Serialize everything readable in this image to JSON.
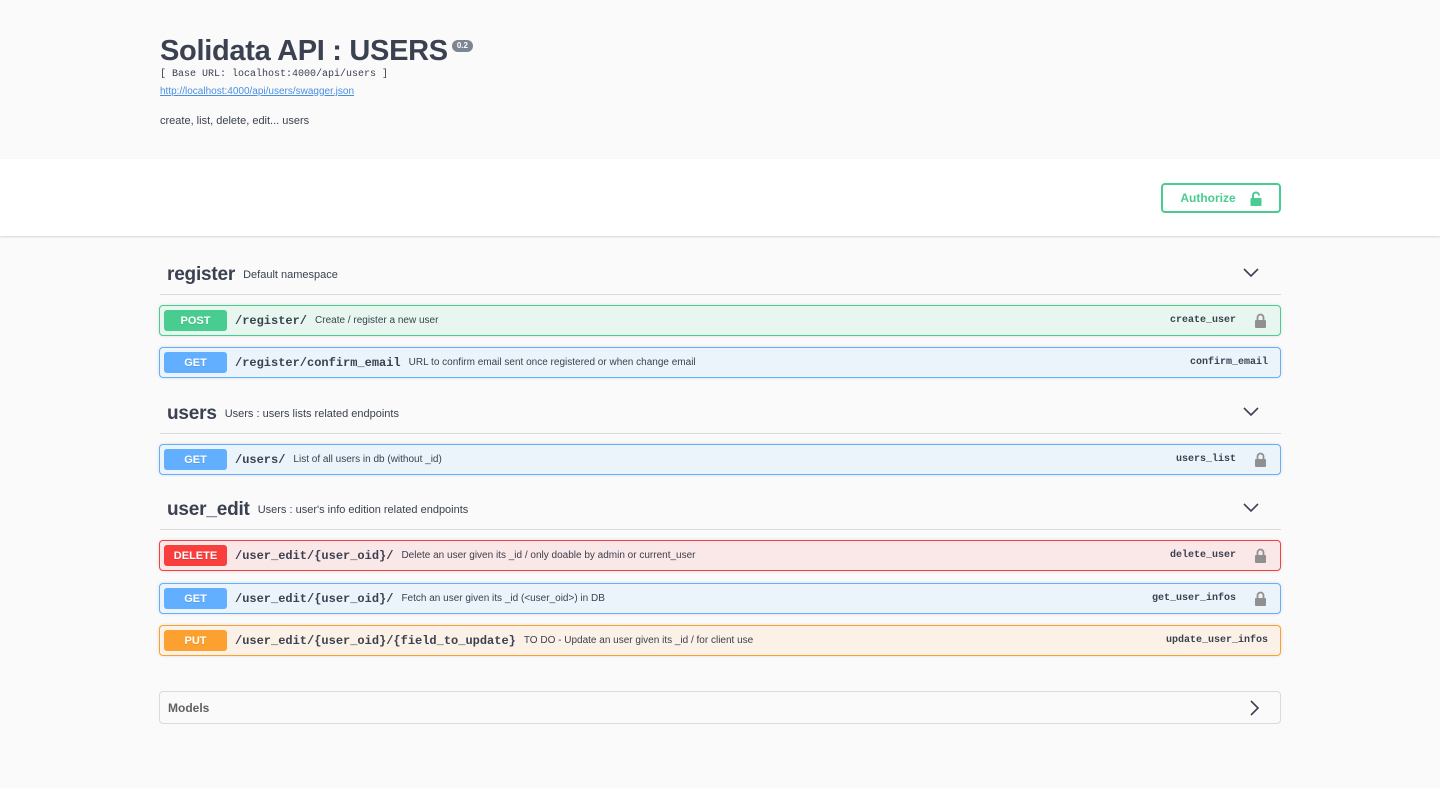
{
  "info": {
    "title": "Solidata API : USERS",
    "version": "0.2",
    "base_url": "[ Base URL: localhost:4000/api/users ]",
    "spec_link": "http://localhost:4000/api/users/swagger.json",
    "description": "create, list, delete, edit... users"
  },
  "authorize": {
    "label": "Authorize",
    "icon": "unlock-icon",
    "color": "#49cc90"
  },
  "colors": {
    "post": "#49cc90",
    "get": "#61affe",
    "delete": "#f93e3e",
    "put": "#fca130"
  },
  "tags": [
    {
      "name": "register",
      "description": "Default namespace",
      "operations": [
        {
          "method": "POST",
          "path": "/register/",
          "summary": "Create / register a new user",
          "operation_id": "create_user",
          "locked": true
        },
        {
          "method": "GET",
          "path": "/register/confirm_email",
          "summary": "URL to confirm email sent once registered or when change email",
          "operation_id": "confirm_email",
          "locked": false
        }
      ]
    },
    {
      "name": "users",
      "description": "Users : users lists related endpoints",
      "operations": [
        {
          "method": "GET",
          "path": "/users/",
          "summary": "List of all users in db (without _id)",
          "operation_id": "users_list",
          "locked": true
        }
      ]
    },
    {
      "name": "user_edit",
      "description": "Users : user's info edition related endpoints",
      "operations": [
        {
          "method": "DELETE",
          "path": "/user_edit/{user_oid}/",
          "summary": "Delete an user given its _id / only doable by admin or current_user",
          "operation_id": "delete_user",
          "locked": true
        },
        {
          "method": "GET",
          "path": "/user_edit/{user_oid}/",
          "summary": "Fetch an user given its _id (<user_oid>) in DB",
          "operation_id": "get_user_infos",
          "locked": true
        },
        {
          "method": "PUT",
          "path": "/user_edit/{user_oid}/{field_to_update}",
          "summary": "TO DO - Update an user given its _id / for client use",
          "operation_id": "update_user_infos",
          "locked": false
        }
      ]
    }
  ],
  "models": {
    "label": "Models"
  }
}
